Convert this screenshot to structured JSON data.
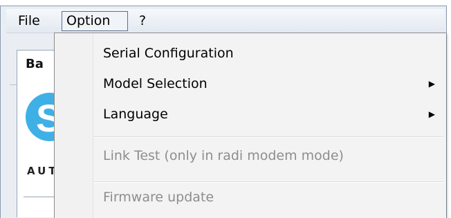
{
  "menubar": {
    "items": [
      {
        "label": "File"
      },
      {
        "label": "Option"
      },
      {
        "label": "?"
      }
    ]
  },
  "background": {
    "tab_label": "Ba",
    "logo_letter": "S",
    "logo_text": "AUT"
  },
  "dropdown": {
    "items": [
      {
        "label": "Serial Configuration",
        "enabled": true,
        "submenu": false
      },
      {
        "label": "Model Selection",
        "enabled": true,
        "submenu": true
      },
      {
        "label": "Language",
        "enabled": true,
        "submenu": true
      },
      {
        "label": "Link Test (only in radi modem mode)",
        "enabled": false,
        "submenu": false
      },
      {
        "label": "Firmware update",
        "enabled": false,
        "submenu": false
      }
    ],
    "submenu_arrow": "▶"
  },
  "colors": {
    "logo_accent": "#3fb0e6",
    "disabled_text": "#8d8d8d"
  }
}
